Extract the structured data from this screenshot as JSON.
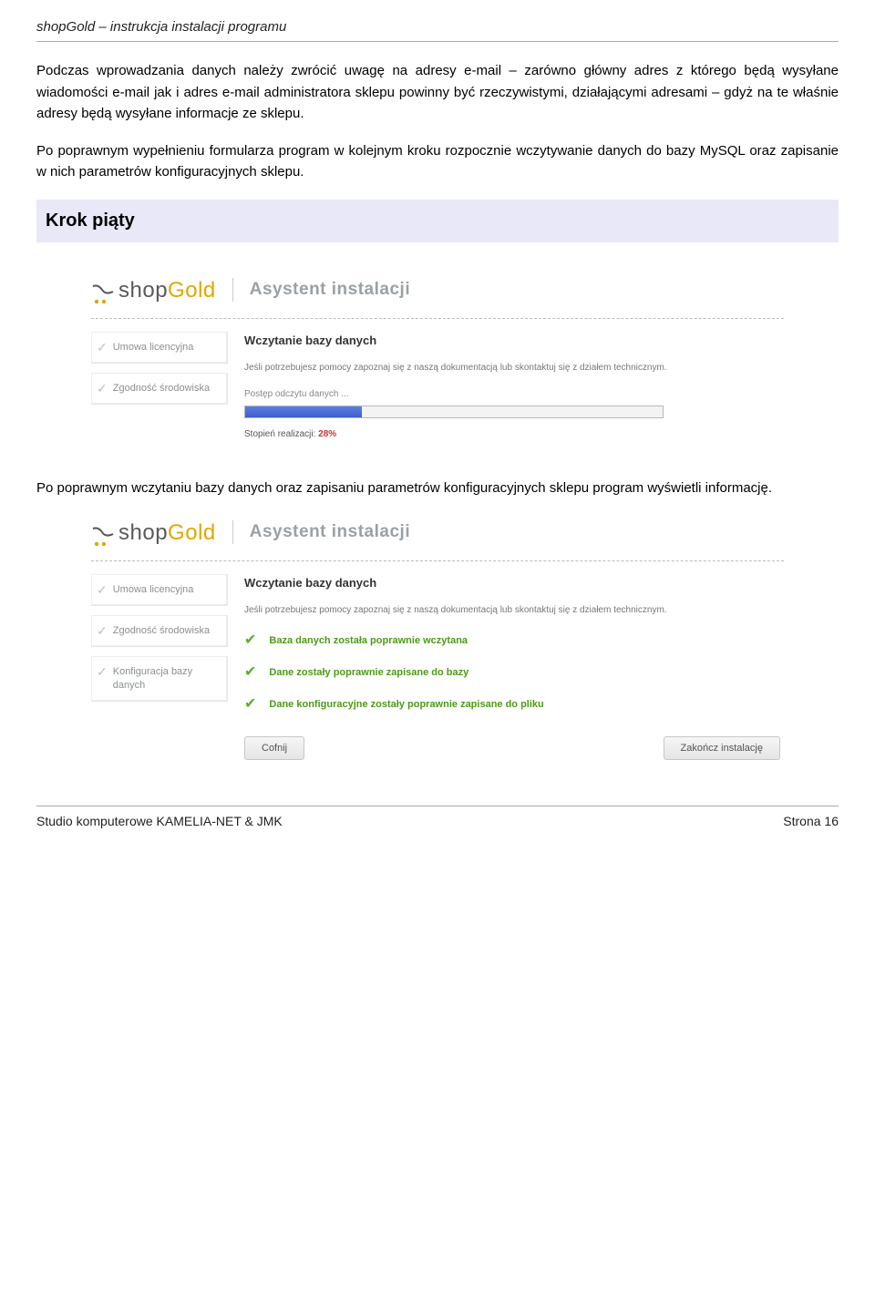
{
  "header": {
    "title_app": "shopGold",
    "title_rest": " – instrukcja instalacji programu"
  },
  "paragraphs": {
    "p1": "Podczas wprowadzania danych należy zwrócić uwagę na adresy e-mail – zarówno główny adres z którego będą wysyłane wiadomości e-mail jak i adres e-mail administratora sklepu powinny być rzeczywistymi, działającymi adresami – gdyż na te właśnie adresy będą wysyłane informacje ze sklepu.",
    "p2": "Po poprawnym wypełnieniu formularza program w kolejnym kroku rozpocznie wczytywanie danych do bazy MySQL oraz zapisanie w nich parametrów konfiguracyjnych sklepu.",
    "p3": "Po poprawnym wczytaniu bazy danych oraz zapisaniu parametrów konfiguracyjnych sklepu program wyświetli informację."
  },
  "section": {
    "title": "Krok piąty"
  },
  "installer": {
    "logo": {
      "shop": "shop",
      "gold": "Gold"
    },
    "asystent": "Asystent instalacji",
    "nav": {
      "umowa": "Umowa licencyjna",
      "zgodnosc": "Zgodność środowiska",
      "konfiguracja": "Konfiguracja bazy danych"
    },
    "content": {
      "heading": "Wczytanie bazy danych",
      "sub": "Jeśli potrzebujesz pomocy zapoznaj się z naszą dokumentacją lub skontaktuj się z działem technicznym.",
      "progress_label": "Postęp odczytu danych ...",
      "progress_pct_label": "Stopień realizacji: ",
      "progress_pct_value": "28%",
      "progress_pct_numeric": 28,
      "ok1": "Baza danych została poprawnie wczytana",
      "ok2": "Dane zostały poprawnie zapisane do bazy",
      "ok3": "Dane konfiguracyjne zostały poprawnie zapisane do pliku",
      "btn_back": "Cofnij",
      "btn_finish": "Zakończ instalację"
    }
  },
  "footer": {
    "left": "Studio komputerowe KAMELIA-NET & JMK",
    "right": "Strona 16"
  }
}
